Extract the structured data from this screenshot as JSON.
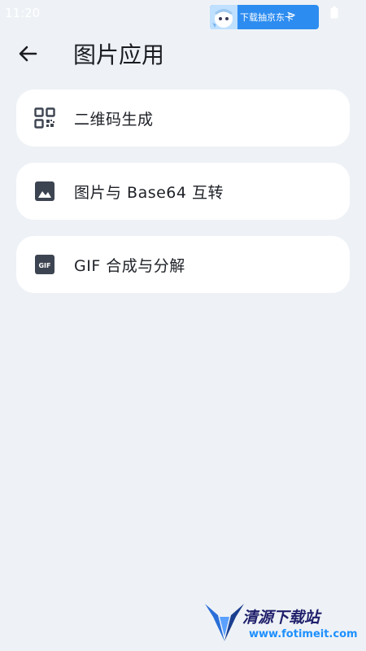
{
  "status_bar": {
    "time": "11:20",
    "icons": [
      "battery-icon"
    ]
  },
  "promo": {
    "text": "下载抽京东卡",
    "chevron": ">"
  },
  "header": {
    "title": "图片应用",
    "back_icon": "arrow-left-icon"
  },
  "menu": {
    "items": [
      {
        "label": "二维码生成",
        "icon": "qr-code-icon"
      },
      {
        "label": "图片与 Base64 互转",
        "icon": "image-icon"
      },
      {
        "label": "GIF 合成与分解",
        "icon": "gif-icon"
      }
    ]
  },
  "watermark": {
    "title": "清源下载站",
    "url": "www.fotimeit.com"
  },
  "colors": {
    "background": "#eef2f6",
    "card": "#ffffff",
    "icon": "#3d4451",
    "text": "#1d2026"
  }
}
